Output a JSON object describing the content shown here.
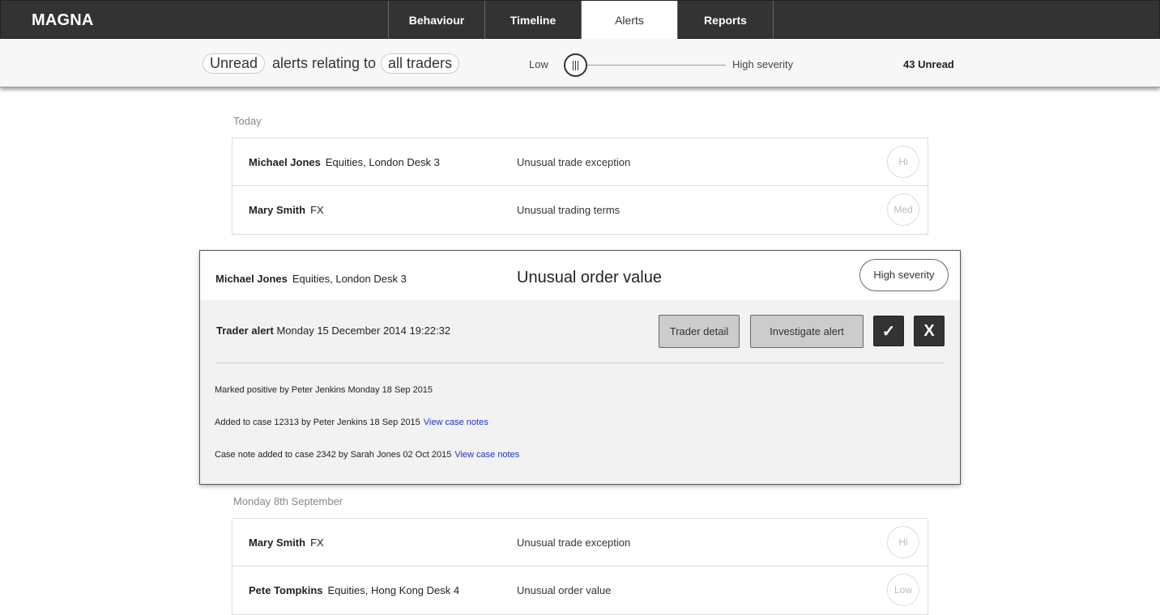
{
  "app": {
    "brand": "MAGNA"
  },
  "nav": {
    "tabs": [
      {
        "label": "Behaviour",
        "active": false
      },
      {
        "label": "Timeline",
        "active": false
      },
      {
        "label": "Alerts",
        "active": true
      },
      {
        "label": "Reports",
        "active": false
      }
    ]
  },
  "filter": {
    "status_pill": "Unread",
    "relating_text": "alerts relating to",
    "traders_pill": "all traders",
    "severity_low_label": "Low",
    "severity_high_label": "High severity",
    "severity_level": 0,
    "unread_count": "43 Unread"
  },
  "groups": [
    {
      "label": "Today",
      "alerts": [
        {
          "trader": "Michael Jones",
          "desk": "Equities, London Desk 3",
          "type": "Unusual trade exception",
          "severity": "Hi"
        },
        {
          "trader": "Mary Smith",
          "desk": "FX",
          "type": "Unusual trading terms",
          "severity": "Med"
        }
      ]
    },
    {
      "label": "Monday 8th September",
      "alerts": [
        {
          "trader": "Mary Smith",
          "desk": "FX",
          "type": "Unusual trade exception",
          "severity": "Hi"
        },
        {
          "trader": "Pete Tompkins",
          "desk": "Equities, Hong Kong Desk 4",
          "type": "Unusual order value",
          "severity": "Low"
        }
      ]
    }
  ],
  "expanded": {
    "trader": "Michael Jones",
    "desk": "Equities, London Desk 3",
    "title": "Unusual order value",
    "severity": "High severity",
    "alert_label": "Trader alert",
    "alert_date": "Monday 15 December 2014 19:22:32",
    "buttons": {
      "trader_detail": "Trader detail",
      "investigate": "Investigate alert",
      "accept": "✓",
      "reject": "X"
    },
    "history": [
      {
        "text": "Marked positive by Peter Jenkins Monday 18 Sep 2015",
        "link": ""
      },
      {
        "text": "Added to case 12313 by Peter Jenkins 18 Sep 2015",
        "link": "View case notes"
      },
      {
        "text": "Case note added to case 2342 by Sarah Jones 02 Oct 2015",
        "link": "View case notes"
      }
    ]
  }
}
